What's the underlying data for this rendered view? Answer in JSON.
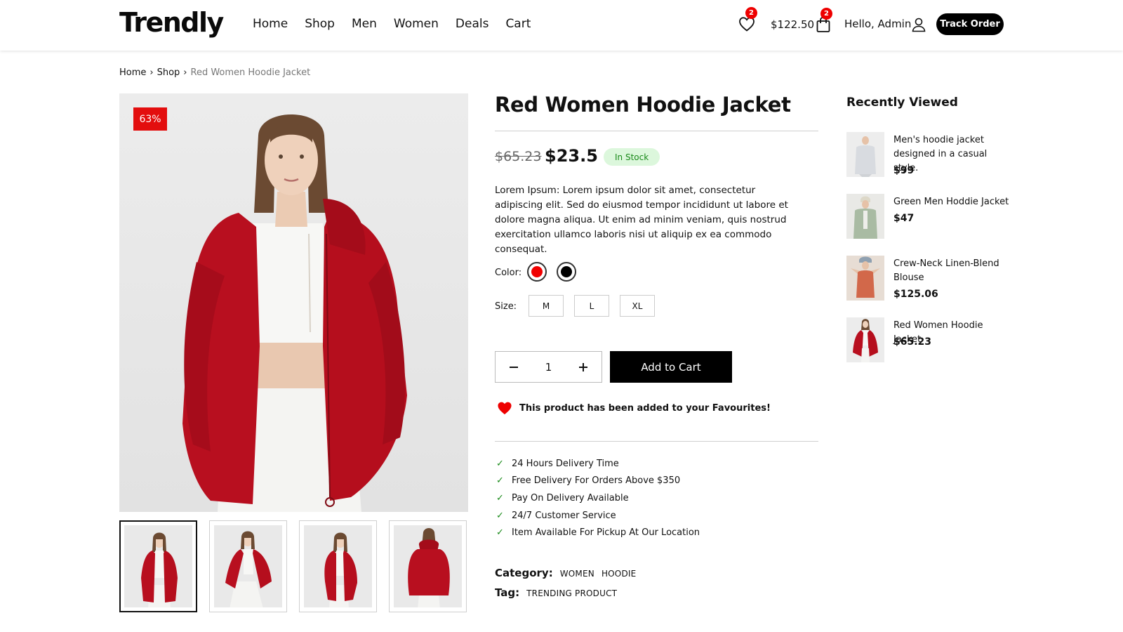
{
  "header": {
    "logo": "Trendly",
    "nav": [
      "Home",
      "Shop",
      "Men",
      "Women",
      "Deals",
      "Cart"
    ],
    "wishlist_count": "2",
    "cart_total": "$122.50",
    "cart_count": "2",
    "greeting": "Hello, Admin",
    "track_order_label": "Track Order"
  },
  "breadcrumb": {
    "items": [
      "Home",
      "Shop"
    ],
    "separator": "›",
    "current": "Red Women Hoodie Jacket"
  },
  "product": {
    "discount_badge": "63%",
    "title": "Red Women Hoodie Jacket",
    "old_price": "$65.23",
    "price": "$23.5",
    "stock_status": "In Stock",
    "description": "Lorem Ipsum: Lorem ipsum dolor sit amet, consectetur adipiscing elit. Sed do eiusmod tempor incididunt ut labore et dolore magna aliqua. Ut enim ad minim veniam, quis nostrud exercitation ullamco laboris nisi ut aliquip ex ea commodo consequat.",
    "color_label": "Color:",
    "colors": [
      "#f00000",
      "#000000"
    ],
    "size_label": "Size:",
    "sizes": [
      "M",
      "L",
      "XL"
    ],
    "quantity": "1",
    "add_to_cart_label": "Add to Cart",
    "favourite_message": "This product has been added to your Favourites!",
    "features": [
      "24 Hours Delivery Time",
      "Free Delivery For Orders Above $350",
      "Pay On Delivery Available",
      "24/7 Customer Service",
      "Item Available For Pickup At Our Location"
    ],
    "category_label": "Category:",
    "categories": [
      "WOMEN",
      "HOODIE"
    ],
    "tag_label": "Tag:",
    "tags": [
      "TRENDING PRODUCT"
    ]
  },
  "recently_viewed": {
    "title": "Recently Viewed",
    "items": [
      {
        "name": "Men's hoodie jacket designed in a casual style.",
        "price": "$99"
      },
      {
        "name": "Green Men Hoddie Jacket",
        "price": "$47"
      },
      {
        "name": "Crew-Neck Linen-Blend Blouse",
        "price": "$125.06"
      },
      {
        "name": "Red Women Hoodie Jacket",
        "price": "$65.23"
      }
    ]
  },
  "colors": {
    "accent": "#000000",
    "sale_badge": "#e30e0e",
    "stock_bg": "#dcf7dc",
    "stock_text": "#1a8a1a",
    "jacket_red": "#b80f1f"
  }
}
